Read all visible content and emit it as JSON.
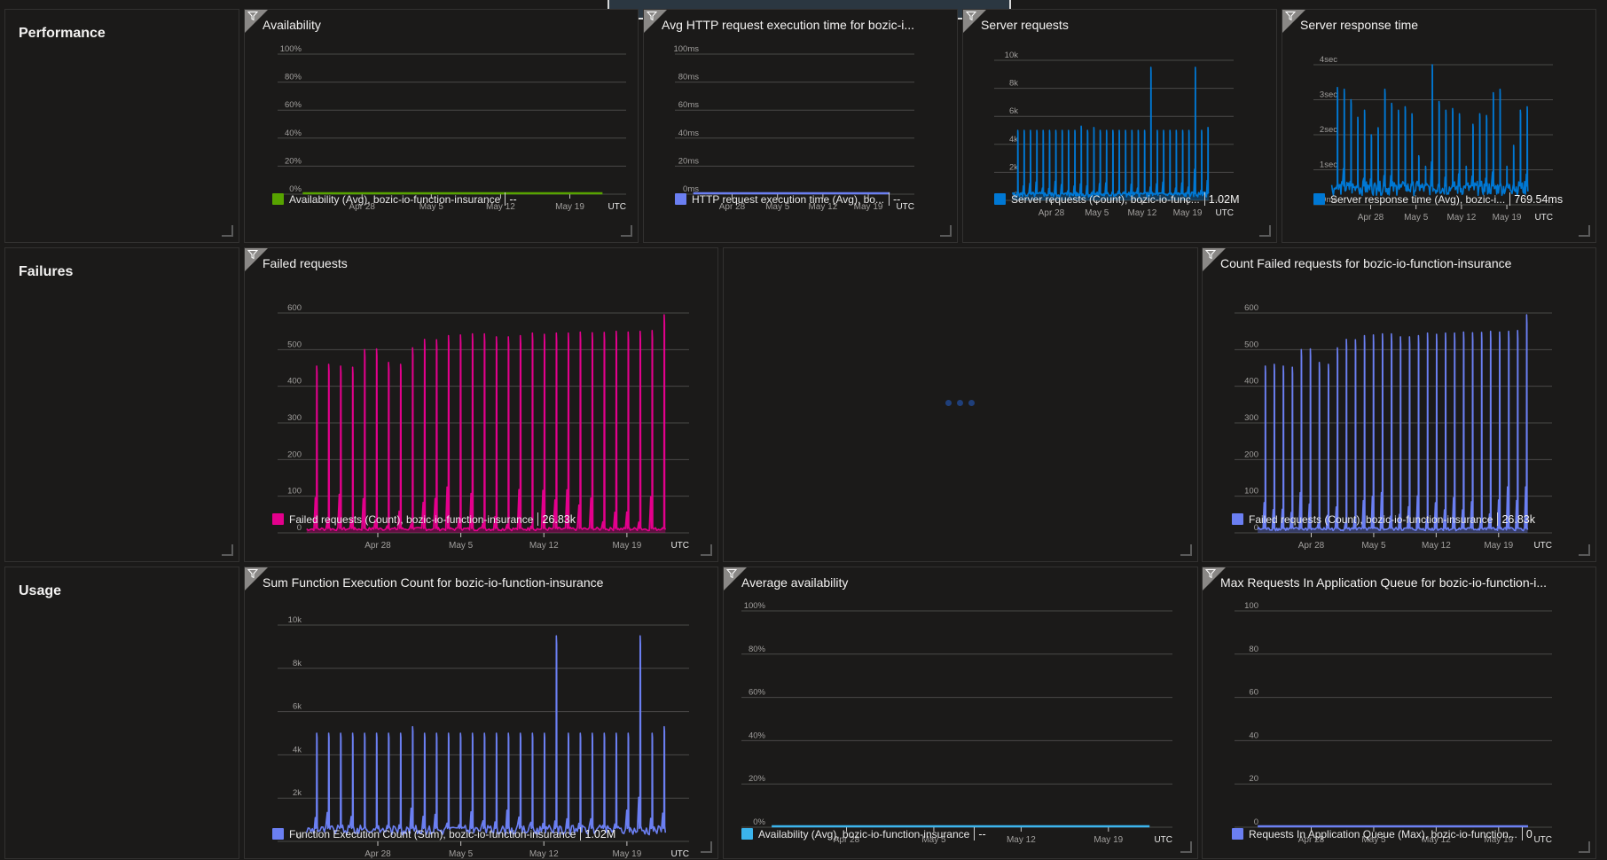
{
  "sections": [
    {
      "label": "Performance"
    },
    {
      "label": "Failures"
    },
    {
      "label": "Usage"
    }
  ],
  "tiles": {
    "availability": {
      "title": "Availability",
      "legend": "Availability (Avg), bozic-io-function-insurance",
      "value": "--",
      "color": "#57a300"
    },
    "http_exec": {
      "title": "Avg HTTP request execution time for bozic-i...",
      "legend": "HTTP request execution time (Avg), bo...",
      "value": "--",
      "color": "#6b7ff2"
    },
    "server_requests": {
      "title": "Server requests",
      "legend": "Server requests (Count), bozic-io-func...",
      "value": "1.02M",
      "color": "#0078d4"
    },
    "server_response": {
      "title": "Server response time",
      "legend": "Server response time (Avg), bozic-i...",
      "value": "769.54ms",
      "color": "#0078d4"
    },
    "failed_requests": {
      "title": "Failed requests",
      "legend": "Failed requests (Count), bozic-io-function-insurance",
      "value": "26.83k",
      "color": "#e3008c"
    },
    "loading": {
      "state": "loading"
    },
    "count_failed": {
      "title": "Count Failed requests for bozic-io-function-insurance",
      "legend": "Failed requests (Count), bozic-io-function-insurance",
      "value": "26.83k",
      "color": "#6b7ff2"
    },
    "func_exec": {
      "title": "Sum Function Execution Count for bozic-io-function-insurance",
      "legend": "Function Execution Count (Sum), bozic-io-function-insurance",
      "value": "1.02M",
      "color": "#6b7ff2"
    },
    "avg_availability": {
      "title": "Average availability",
      "legend": "Availability (Avg), bozic-io-function-insurance",
      "value": "--",
      "color": "#3bb4ec"
    },
    "app_queue": {
      "title": "Max Requests In Application Queue for bozic-io-function-i...",
      "legend": "Requests In Application Queue (Max), bozic-io-function...",
      "value": "0",
      "color": "#6b7ff2"
    }
  },
  "chart_data": [
    {
      "id": "availability",
      "type": "line",
      "title": "Availability",
      "yticks": [
        "0%",
        "20%",
        "40%",
        "60%",
        "80%",
        "100%"
      ],
      "ylim": [
        0,
        100
      ],
      "xticks": [
        "Apr 28",
        "May 5",
        "May 12",
        "May 19"
      ],
      "timezone": "UTC",
      "x_range_days": [
        "Apr 22",
        "May 23"
      ],
      "series": [
        {
          "name": "Availability (Avg), bozic-io-function-insurance",
          "kind": "flat",
          "values": [
            0
          ]
        }
      ]
    },
    {
      "id": "http_exec",
      "type": "line",
      "title": "Avg HTTP request execution time",
      "yticks": [
        "0ms",
        "20ms",
        "40ms",
        "60ms",
        "80ms",
        "100ms"
      ],
      "ylim": [
        0,
        100
      ],
      "xticks": [
        "Apr 28",
        "May 5",
        "May 12",
        "May 19"
      ],
      "timezone": "UTC",
      "series": [
        {
          "name": "HTTP request execution time (Avg)",
          "kind": "flat",
          "values": [
            0
          ]
        }
      ]
    },
    {
      "id": "server_requests",
      "type": "area",
      "title": "Server requests",
      "yticks": [
        "0",
        "2k",
        "4k",
        "6k",
        "8k",
        "10k"
      ],
      "ylim": [
        0,
        10000
      ],
      "xticks": [
        "Apr 28",
        "May 5",
        "May 12",
        "May 19"
      ],
      "timezone": "UTC",
      "series": [
        {
          "name": "Server requests (Count)",
          "kind": "daily-spikes",
          "baseline": 400,
          "peaks": [
            5000,
            5000,
            5000,
            5000,
            5000,
            5000,
            5000,
            5000,
            5000,
            5000,
            5300,
            5000,
            5200,
            5000,
            5000,
            5000,
            5000,
            5000,
            5000,
            5000,
            5000,
            9500,
            5000,
            5000,
            5000,
            5000,
            5000,
            5000,
            9500,
            5000,
            5200
          ]
        }
      ]
    },
    {
      "id": "server_response",
      "type": "line",
      "title": "Server response time",
      "yticks": [
        "0ms",
        "1sec",
        "2sec",
        "3sec",
        "4sec"
      ],
      "ylim": [
        0,
        4
      ],
      "xticks": [
        "Apr 28",
        "May 5",
        "May 12",
        "May 19"
      ],
      "timezone": "UTC",
      "series": [
        {
          "name": "Server response time (Avg)",
          "kind": "daily-spikes",
          "baseline": 0.45,
          "peaks": [
            3.35,
            3.3,
            3.0,
            2.5,
            2.7,
            2.0,
            2.2,
            3.3,
            2.9,
            2.7,
            2.8,
            2.6,
            1.4,
            1.1,
            4.0,
            2.95,
            2.7,
            2.75,
            2.6,
            1.1,
            2.3,
            2.6,
            2.55,
            3.2,
            3.3,
            1.1,
            1.7,
            2.7,
            2.8
          ]
        }
      ]
    },
    {
      "id": "failed_requests",
      "type": "line",
      "title": "Failed requests",
      "yticks": [
        "0",
        "100",
        "200",
        "300",
        "400",
        "500",
        "600"
      ],
      "ylim": [
        0,
        600
      ],
      "xticks": [
        "Apr 28",
        "May 5",
        "May 12",
        "May 19"
      ],
      "timezone": "UTC",
      "series": [
        {
          "name": "Failed requests (Count)",
          "kind": "daily-spikes",
          "baseline": 10,
          "peaks": [
            455,
            460,
            455,
            452,
            500,
            502,
            465,
            460,
            505,
            528,
            527,
            538,
            540,
            543,
            543,
            535,
            535,
            538,
            545,
            542,
            545,
            545,
            548,
            546,
            547,
            550,
            548,
            550,
            552,
            595
          ]
        }
      ]
    },
    {
      "id": "count_failed",
      "type": "line",
      "title": "Count Failed requests for bozic-io-function-insurance",
      "yticks": [
        "0",
        "100",
        "200",
        "300",
        "400",
        "500",
        "600"
      ],
      "ylim": [
        0,
        600
      ],
      "xticks": [
        "Apr 28",
        "May 5",
        "May 12",
        "May 19"
      ],
      "timezone": "UTC",
      "series": [
        {
          "name": "Failed requests (Count)",
          "kind": "daily-spikes",
          "baseline": 10,
          "peaks": [
            455,
            460,
            455,
            452,
            500,
            502,
            465,
            460,
            505,
            528,
            527,
            538,
            540,
            543,
            543,
            535,
            535,
            538,
            545,
            542,
            545,
            545,
            548,
            546,
            547,
            550,
            548,
            550,
            552,
            595
          ]
        }
      ]
    },
    {
      "id": "func_exec",
      "type": "line",
      "title": "Sum Function Execution Count",
      "yticks": [
        "0",
        "2k",
        "4k",
        "6k",
        "8k",
        "10k"
      ],
      "ylim": [
        0,
        10000
      ],
      "xticks": [
        "Apr 28",
        "May 5",
        "May 12",
        "May 19"
      ],
      "timezone": "UTC",
      "series": [
        {
          "name": "Function Execution Count (Sum)",
          "kind": "daily-spikes",
          "baseline": 500,
          "peaks": [
            5000,
            5000,
            5000,
            5000,
            5000,
            5000,
            5000,
            5000,
            5300,
            5000,
            5000,
            5000,
            5000,
            5000,
            5000,
            5000,
            5000,
            5000,
            5000,
            5000,
            9500,
            5000,
            5000,
            5000,
            5000,
            5000,
            5000,
            9500,
            5000,
            5300
          ]
        }
      ]
    },
    {
      "id": "avg_availability",
      "type": "line",
      "title": "Average availability",
      "yticks": [
        "0%",
        "20%",
        "40%",
        "60%",
        "80%",
        "100%"
      ],
      "ylim": [
        0,
        100
      ],
      "xticks": [
        "Apr 28",
        "May 5",
        "May 12",
        "May 19"
      ],
      "timezone": "UTC",
      "series": [
        {
          "name": "Availability (Avg)",
          "kind": "flat",
          "values": [
            0
          ]
        }
      ]
    },
    {
      "id": "app_queue",
      "type": "line",
      "title": "Max Requests In Application Queue",
      "yticks": [
        "0",
        "20",
        "40",
        "60",
        "80",
        "100"
      ],
      "ylim": [
        0,
        100
      ],
      "xticks": [
        "Apr 28",
        "May 5",
        "May 12",
        "May 19"
      ],
      "timezone": "UTC",
      "series": [
        {
          "name": "Requests In Application Queue (Max)",
          "kind": "flat",
          "values": [
            0
          ]
        }
      ]
    }
  ]
}
